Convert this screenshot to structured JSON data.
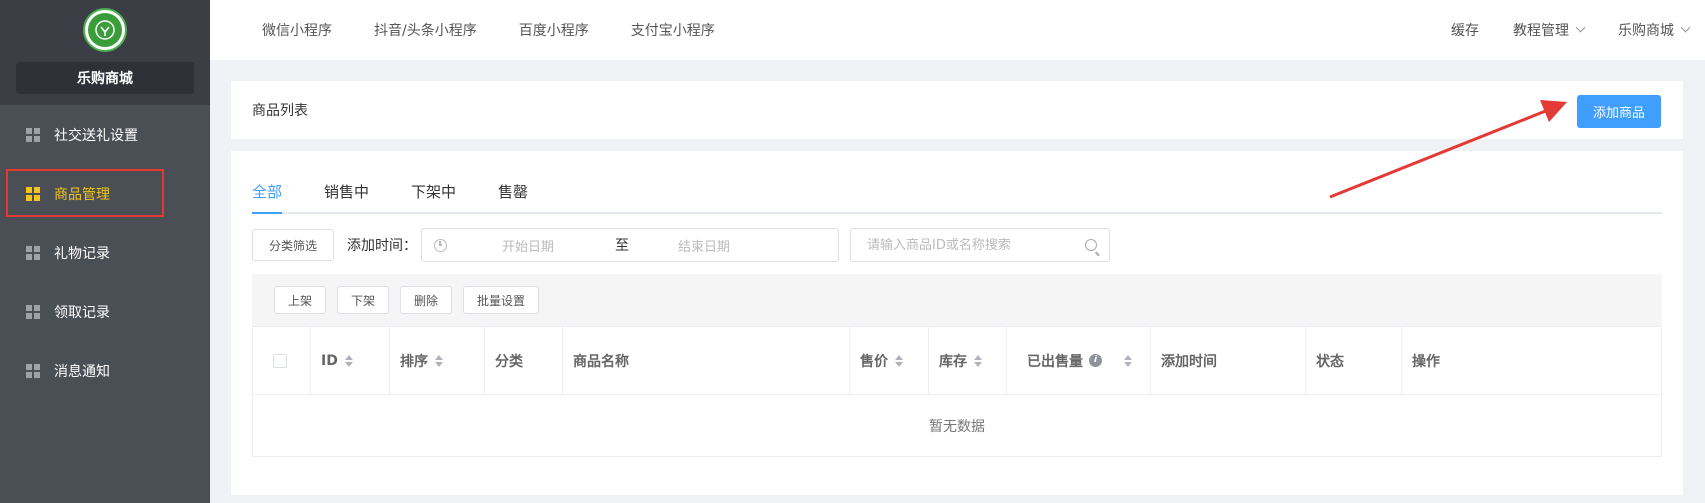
{
  "sidebar": {
    "shop_name": "乐购商城",
    "items": [
      {
        "label": "社交送礼设置",
        "icon": "grid-icon",
        "active": false
      },
      {
        "label": "商品管理",
        "icon": "grid-icon",
        "active": true
      },
      {
        "label": "礼物记录",
        "icon": "grid-icon",
        "active": false
      },
      {
        "label": "领取记录",
        "icon": "grid-icon",
        "active": false
      },
      {
        "label": "消息通知",
        "icon": "grid-icon",
        "active": false
      }
    ]
  },
  "topnav": {
    "links": [
      "微信小程序",
      "抖音/头条小程序",
      "百度小程序",
      "支付宝小程序"
    ],
    "cache": "缓存",
    "tutorial": "教程管理",
    "shop": "乐购商城"
  },
  "header": {
    "title": "商品列表",
    "add_button": "添加商品"
  },
  "tabs": [
    "全部",
    "销售中",
    "下架中",
    "售罄"
  ],
  "filters": {
    "category_button": "分类筛选",
    "time_label": "添加时间：",
    "start_placeholder": "开始日期",
    "separator": "至",
    "end_placeholder": "结束日期",
    "search_placeholder": "请输入商品ID或名称搜索"
  },
  "actions": [
    "上架",
    "下架",
    "删除",
    "批量设置"
  ],
  "table": {
    "columns": [
      "ID",
      "排序",
      "分类",
      "商品名称",
      "售价",
      "库存",
      "已出售量",
      "添加时间",
      "状态",
      "操作"
    ],
    "empty_text": "暂无数据"
  },
  "colors": {
    "primary": "#409eff",
    "sidebar_bg": "#4a4e55",
    "active_menu": "#f5c518",
    "highlight_border": "#e53935",
    "annotation_arrow": "#e53935"
  }
}
